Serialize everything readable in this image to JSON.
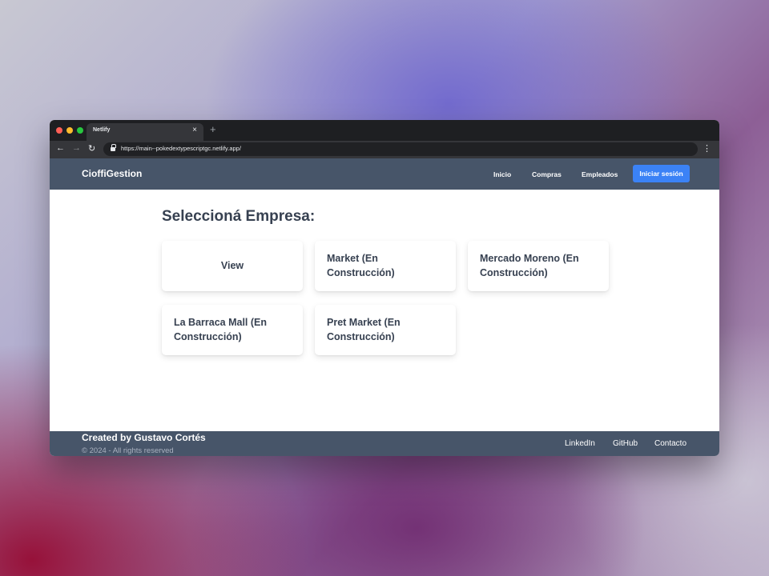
{
  "browser": {
    "tab_title": "Netlify",
    "tab_close": "×",
    "new_tab": "+",
    "url": "https://main--pokedextypescriptgc.netlify.app/",
    "back": "←",
    "forward": "→",
    "reload": "↻",
    "menu": "⋮",
    "traffic_lights": [
      "#ff5f57",
      "#febc2e",
      "#28c840"
    ]
  },
  "navbar": {
    "brand": "CioffiGestion",
    "links": [
      "Inicio",
      "Compras",
      "Empleados"
    ],
    "login_button": "Iniciar sesión",
    "background": "#475569",
    "accent": "#3b82f6"
  },
  "main": {
    "heading": "Seleccioná Empresa:",
    "companies": [
      "View",
      "Market (En Construcción)",
      "Mercado Moreno (En Construcción)",
      "La Barraca Mall (En Construcción)",
      "Pret Market (En Construcción)"
    ]
  },
  "footer": {
    "credit": "Created by Gustavo Cortés",
    "copyright": "© 2024 - All rights reserved",
    "links": [
      "LinkedIn",
      "GitHub",
      "Contacto"
    ]
  }
}
